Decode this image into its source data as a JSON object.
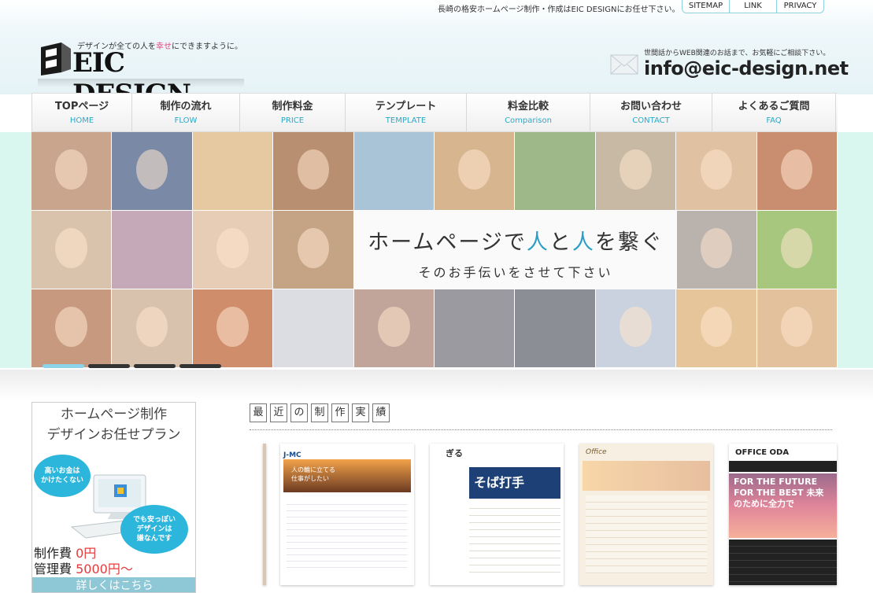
{
  "topbar": {
    "tagline": "長崎の格安ホームページ制作・作成はEIC DESIGNにお任せ下さい。",
    "links": [
      "SITEMAP",
      "LINK",
      "PRIVACY"
    ]
  },
  "logo": {
    "catch_pre": "デザインが全ての人を",
    "catch_accent": "幸せ",
    "catch_post": "にできますように。",
    "name": "EIC DESIGN"
  },
  "contact": {
    "note": "世間話からWEB関連のお話まで、お気軽にご相談下さい。",
    "email": "info@eic-design.net"
  },
  "nav": {
    "items": [
      {
        "ja": "TOPページ",
        "en": "HOME"
      },
      {
        "ja": "制作の流れ",
        "en": "FLOW"
      },
      {
        "ja": "制作料金",
        "en": "PRICE"
      },
      {
        "ja": "テンプレート",
        "en": "TEMPLATE"
      },
      {
        "ja": "料金比較",
        "en": "Comparison"
      },
      {
        "ja": "お問い合わせ",
        "en": "CONTACT"
      },
      {
        "ja": "よくあるご質問",
        "en": "FAQ"
      }
    ]
  },
  "slider": {
    "main_pre": "ホームページで",
    "main_a": "人",
    "main_mid": "と",
    "main_b": "人",
    "main_post": "を繋ぐ",
    "sub": "そのお手伝いをさせて下さい",
    "slide_count": 4,
    "active_slide": 1
  },
  "plan": {
    "title_line1": "ホームページ制作",
    "title_line2": "デザインお任せプラン",
    "bubble1": "高いお金は\nかけたくない",
    "bubble2": "でも安っぽい\nデザインは\n嫌なんです",
    "fee_label": "制作費",
    "fee_value": "0円",
    "mgmt_label": "管理費",
    "mgmt_value": "5000円〜",
    "button": "詳しくはこちら"
  },
  "works": {
    "heading": [
      "最",
      "近",
      "の",
      "制",
      "作",
      "実",
      "績"
    ],
    "thumbs": [
      {
        "title": "J-MC",
        "copy": "人の輪に立てる仕事がしたい"
      },
      {
        "title": "ぎる",
        "copy": "そば打手"
      },
      {
        "title": "Office",
        "copy": ""
      },
      {
        "title": "OFFICE ODA",
        "copy": "FOR THE FUTURE FOR THE BEST 未来のために全力で"
      }
    ]
  },
  "colors": {
    "accent": "#2aa9c7",
    "band": "#d9f6ef",
    "dot_active": "#8ad3e8",
    "price_red": "#e23c3c"
  }
}
